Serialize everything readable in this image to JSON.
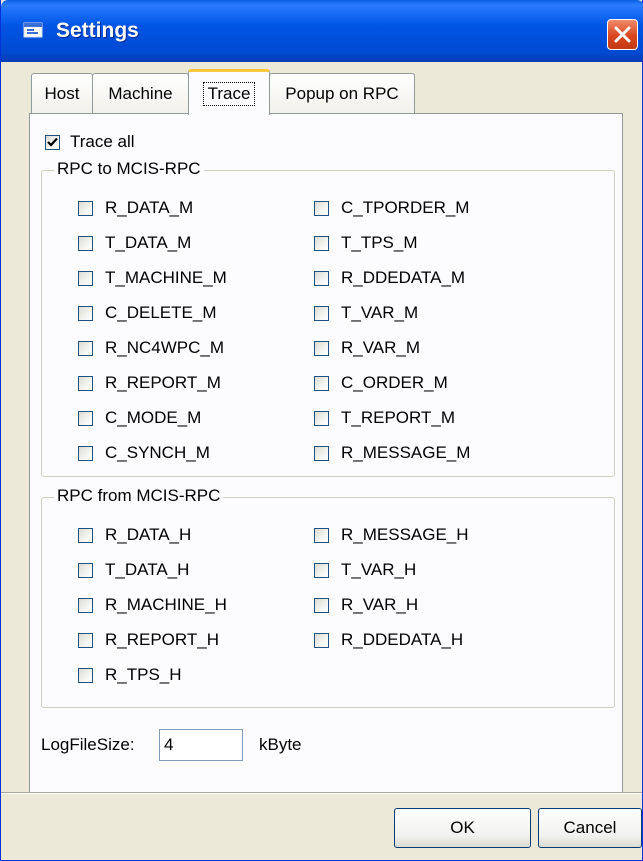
{
  "window": {
    "title": "Settings",
    "icon": "settings-app-icon",
    "close_icon": "close-icon"
  },
  "tabs": [
    {
      "label": "Host",
      "active": false
    },
    {
      "label": "Machine",
      "active": false
    },
    {
      "label": "Trace",
      "active": true
    },
    {
      "label": "Popup on RPC",
      "active": false
    }
  ],
  "trace_all": {
    "label": "Trace all",
    "checked": true
  },
  "group_to": {
    "title": "RPC to MCIS-RPC",
    "left": [
      {
        "label": "R_DATA_M",
        "checked": false
      },
      {
        "label": "T_DATA_M",
        "checked": false
      },
      {
        "label": "T_MACHINE_M",
        "checked": false
      },
      {
        "label": "C_DELETE_M",
        "checked": false
      },
      {
        "label": "R_NC4WPC_M",
        "checked": false
      },
      {
        "label": "R_REPORT_M",
        "checked": false
      },
      {
        "label": "C_MODE_M",
        "checked": false
      },
      {
        "label": "C_SYNCH_M",
        "checked": false
      }
    ],
    "right": [
      {
        "label": "C_TPORDER_M",
        "checked": false
      },
      {
        "label": "T_TPS_M",
        "checked": false
      },
      {
        "label": "R_DDEDATA_M",
        "checked": false
      },
      {
        "label": "T_VAR_M",
        "checked": false
      },
      {
        "label": "R_VAR_M",
        "checked": false
      },
      {
        "label": "C_ORDER_M",
        "checked": false
      },
      {
        "label": "T_REPORT_M",
        "checked": false
      },
      {
        "label": "R_MESSAGE_M",
        "checked": false
      }
    ]
  },
  "group_from": {
    "title": "RPC from MCIS-RPC",
    "left": [
      {
        "label": "R_DATA_H",
        "checked": false
      },
      {
        "label": "T_DATA_H",
        "checked": false
      },
      {
        "label": "R_MACHINE_H",
        "checked": false
      },
      {
        "label": "R_REPORT_H",
        "checked": false
      },
      {
        "label": "R_TPS_H",
        "checked": false
      }
    ],
    "right": [
      {
        "label": "R_MESSAGE_H",
        "checked": false
      },
      {
        "label": "T_VAR_H",
        "checked": false
      },
      {
        "label": "R_VAR_H",
        "checked": false
      },
      {
        "label": "R_DDEDATA_H",
        "checked": false
      }
    ]
  },
  "log": {
    "label": "LogFileSize:",
    "value": "4",
    "unit": "kByte"
  },
  "buttons": {
    "ok": "OK",
    "cancel": "Cancel"
  }
}
